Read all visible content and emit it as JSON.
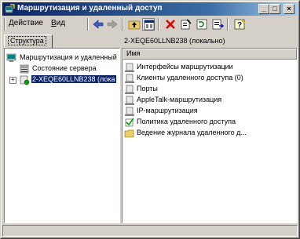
{
  "window": {
    "title": "Маршрутизация и удаленный доступ",
    "minimize": "_",
    "maximize": "□",
    "close": "×"
  },
  "menu": {
    "action": "Действие",
    "action_underline": "Д",
    "action_rest": "ействие",
    "view": "Вид",
    "view_underline": "В",
    "view_rest": "ид"
  },
  "toolbar": {
    "icons": [
      "back-icon",
      "forward-icon",
      "up-folder-icon",
      "properties-view-icon",
      "delete-icon",
      "properties-icon",
      "refresh-icon",
      "export-list-icon",
      "help-icon"
    ]
  },
  "left": {
    "tab_label": "Структура",
    "tree": [
      {
        "label": "Маршрутизация и удаленный",
        "icon": "routing-root-icon"
      },
      {
        "label": "Состояние сервера",
        "icon": "server-status-icon",
        "expander": "-"
      },
      {
        "label": "2-XEQE60LLNB238 (лока",
        "icon": "server-icon",
        "expander": "+",
        "selected": true
      }
    ]
  },
  "right": {
    "header": "2-XEQE60LLNB238 (локально)",
    "column": "Имя",
    "items": [
      {
        "label": "Интерфейсы маршрутизации",
        "icon": "interfaces-icon"
      },
      {
        "label": "Клиенты удаленного доступа (0)",
        "icon": "clients-icon"
      },
      {
        "label": "Порты",
        "icon": "ports-icon"
      },
      {
        "label": "AppleTalk-маршрутизация",
        "icon": "appletalk-icon"
      },
      {
        "label": "IP-маршрутизация",
        "icon": "ip-routing-icon"
      },
      {
        "label": "Политика удаленного доступа",
        "icon": "policy-icon"
      },
      {
        "label": "Ведение журнала удаленного д...",
        "icon": "folder-icon"
      }
    ]
  },
  "colors": {
    "title_start": "#0a246a",
    "title_end": "#a6caf0",
    "face": "#d4d0c8",
    "selection": "#0a246a"
  }
}
